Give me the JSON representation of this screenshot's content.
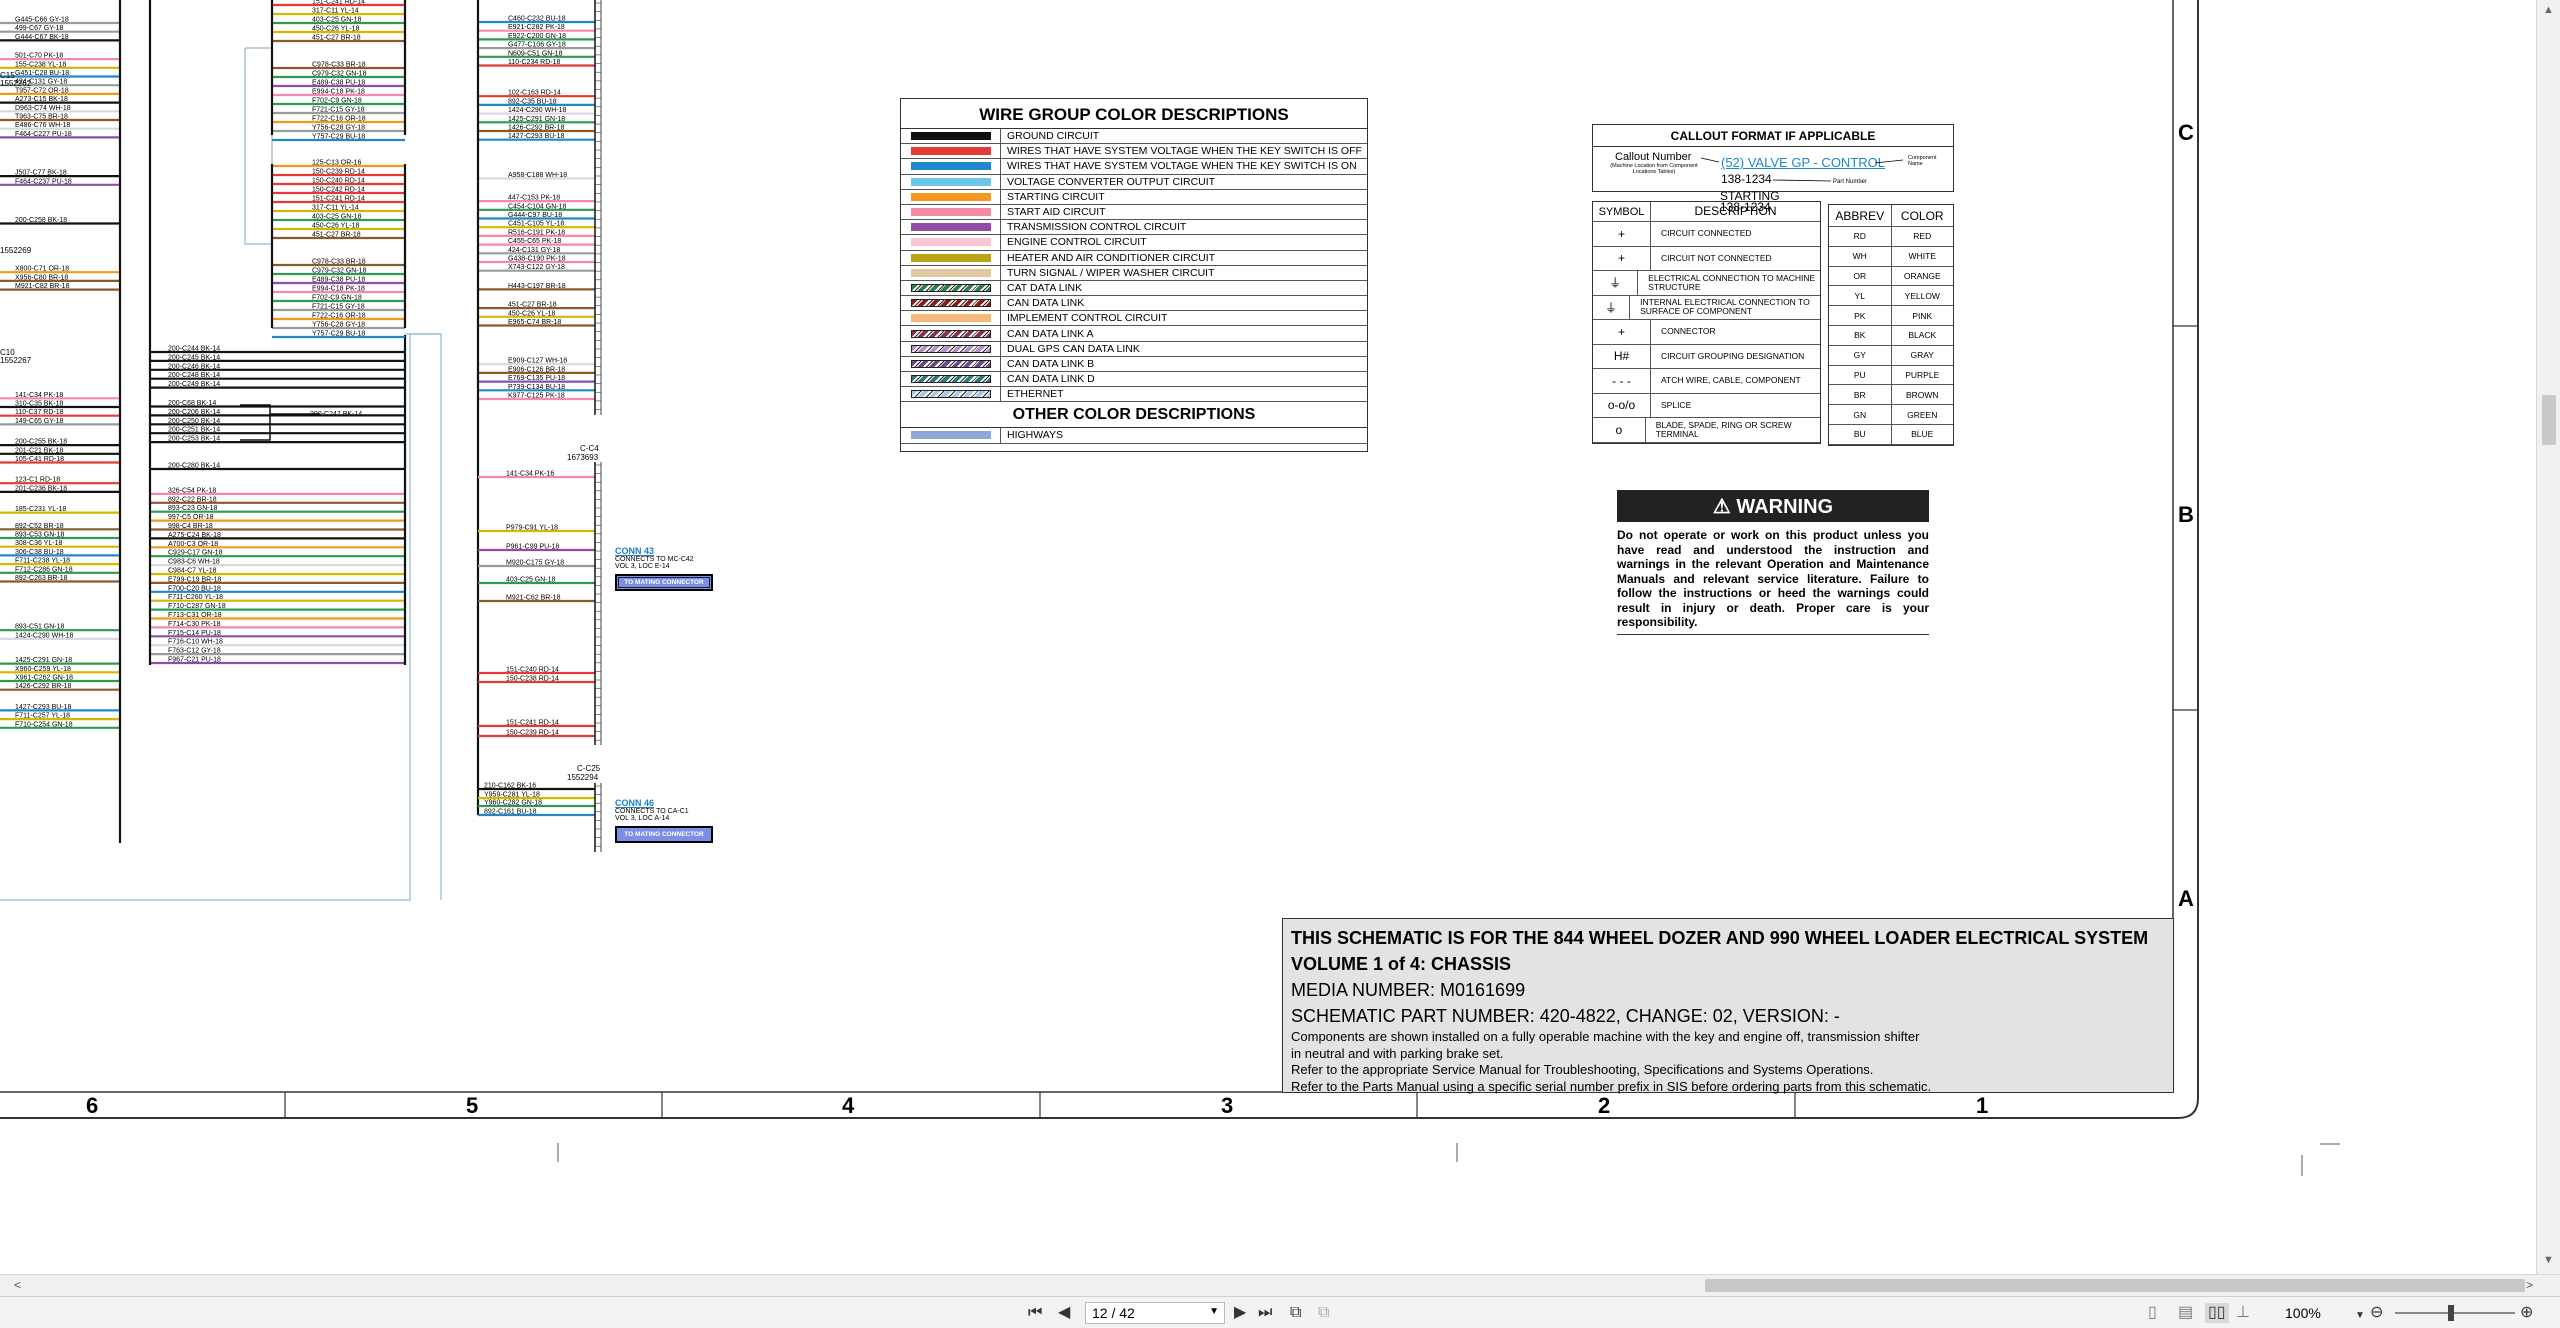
{
  "wire_legend": {
    "title": "WIRE GROUP COLOR DESCRIPTIONS",
    "other_title": "OTHER COLOR DESCRIPTIONS",
    "rows": [
      {
        "label": "GROUND CIRCUIT",
        "color": "#111111",
        "style": "solid"
      },
      {
        "label": "WIRES THAT HAVE SYSTEM VOLTAGE WHEN THE KEY SWITCH IS OFF",
        "color": "#e53935",
        "style": "solid"
      },
      {
        "label": "WIRES THAT HAVE SYSTEM VOLTAGE WHEN THE KEY SWITCH IS ON",
        "color": "#1e88c8",
        "style": "solid"
      },
      {
        "label": "VOLTAGE CONVERTER OUTPUT CIRCUIT",
        "color": "#6ec6e8",
        "style": "solid"
      },
      {
        "label": "STARTING CIRCUIT",
        "color": "#f39a1e",
        "style": "solid"
      },
      {
        "label": "START AID CIRCUIT",
        "color": "#f48aa8",
        "style": "solid"
      },
      {
        "label": "TRANSMISSION CONTROL CIRCUIT",
        "color": "#8e4ea6",
        "style": "solid"
      },
      {
        "label": "ENGINE CONTROL CIRCUIT",
        "color": "#f7c6d0",
        "style": "solid"
      },
      {
        "label": "HEATER AND AIR CONDITIONER CIRCUIT",
        "color": "#b8a419",
        "style": "solid"
      },
      {
        "label": "TURN SIGNAL / WIPER WASHER CIRCUIT",
        "color": "#e0c9a0",
        "style": "solid"
      },
      {
        "label": "CAT DATA LINK",
        "color": "#2e7d4f",
        "style": "hatch"
      },
      {
        "label": "CAN DATA LINK",
        "color": "#8b1a1a",
        "style": "hatch"
      },
      {
        "label": "IMPLEMENT CONTROL CIRCUIT",
        "color": "#f2b97a",
        "style": "solid"
      },
      {
        "label": "CAN DATA LINK A",
        "color": "#8a2b5a",
        "style": "hatch"
      },
      {
        "label": "DUAL GPS CAN DATA LINK",
        "color": "#b48cc8",
        "style": "hatch"
      },
      {
        "label": "CAN DATA LINK B",
        "color": "#6a4a8a",
        "style": "hatch"
      },
      {
        "label": "CAN DATA LINK D",
        "color": "#2a7a7a",
        "style": "hatch"
      },
      {
        "label": "ETHERNET",
        "color": "#a8c8e8",
        "style": "hatch"
      }
    ],
    "other_rows": [
      {
        "label": "HIGHWAYS",
        "color": "#8fa8d8",
        "style": "solid"
      }
    ]
  },
  "callout": {
    "title": "CALLOUT FORMAT IF APPLICABLE",
    "callout_number_label": "Callout Number",
    "callout_number_sub": "(Machine Location from Component Locations Tables)",
    "example_link": "(52) VALVE GP - CONTROL",
    "component_name_label": "Component Name",
    "part_number_1": "138-1234",
    "part_number_label": "Part Number",
    "part_number_2": "STARTING",
    "part_number_3": "138-1234",
    "symbol_header": "SYMBOL",
    "description_header": "DESCRIPTION",
    "symbols": [
      {
        "symbol": "+",
        "description": "CIRCUIT CONNECTED",
        "icon": "circuit-connected-icon"
      },
      {
        "symbol": "+",
        "description": "CIRCUIT NOT CONNECTED",
        "icon": "circuit-not-connected-icon"
      },
      {
        "symbol": "⏚",
        "description": "ELECTRICAL CONNECTION TO MACHINE STRUCTURE",
        "icon": "chassis-ground-icon"
      },
      {
        "symbol": "⏚",
        "description": "INTERNAL ELECTRICAL CONNECTION TO SURFACE OF COMPONENT",
        "icon": "surface-ground-icon"
      },
      {
        "symbol": "+",
        "description": "CONNECTOR",
        "icon": "connector-icon"
      },
      {
        "symbol": "H#",
        "description": "CIRCUIT GROUPING DESIGNATION",
        "icon": "grouping-icon"
      },
      {
        "symbol": "- - -",
        "description": "ATCH WIRE, CABLE, COMPONENT",
        "icon": "attachment-icon"
      },
      {
        "symbol": "o-o/o",
        "description": "SPLICE",
        "icon": "splice-icon"
      },
      {
        "symbol": "o",
        "description": "BLADE, SPADE, RING OR SCREW TERMINAL",
        "icon": "terminal-icon"
      }
    ],
    "abbrev_header": "ABBREV",
    "color_header": "COLOR",
    "abbreviations": [
      {
        "abbrev": "RD",
        "color": "RED"
      },
      {
        "abbrev": "WH",
        "color": "WHITE"
      },
      {
        "abbrev": "OR",
        "color": "ORANGE"
      },
      {
        "abbrev": "YL",
        "color": "YELLOW"
      },
      {
        "abbrev": "PK",
        "color": "PINK"
      },
      {
        "abbrev": "BK",
        "color": "BLACK"
      },
      {
        "abbrev": "GY",
        "color": "GRAY"
      },
      {
        "abbrev": "PU",
        "color": "PURPLE"
      },
      {
        "abbrev": "BR",
        "color": "BROWN"
      },
      {
        "abbrev": "GN",
        "color": "GREEN"
      },
      {
        "abbrev": "BU",
        "color": "BLUE"
      }
    ]
  },
  "warning": {
    "title": "WARNING",
    "text": "Do not operate or work on this product unless you have read and understood the instruction and warnings in the relevant Operation and Maintenance Manuals and relevant service literature. Failure to follow the instructions or heed the warnings could result in injury or death. Proper care is your responsibility."
  },
  "title_block": {
    "line1": "THIS SCHEMATIC IS FOR THE 844 WHEEL DOZER AND 990 WHEEL LOADER ELECTRICAL SYSTEM",
    "line2": "VOLUME 1 of 4: CHASSIS",
    "line3": "MEDIA NUMBER: M0161699",
    "line4": "SCHEMATIC PART NUMBER: 420-4822, CHANGE: 02, VERSION: -",
    "note1": "Components are shown installed on a fully operable machine with the key and engine off, transmission shifter",
    "note2": "in neutral and with parking brake set.",
    "note3": "Refer to the appropriate Service Manual for Troubleshooting, Specifications and Systems Operations.",
    "note4": "Refer to the Parts Manual using a specific serial number prefix in SIS before ordering parts from this schematic."
  },
  "frame": {
    "columns": [
      "6",
      "5",
      "4",
      "3",
      "2",
      "1"
    ],
    "rows": [
      "C",
      "B",
      "A"
    ]
  },
  "connectors": {
    "c4": {
      "id": "C-C4",
      "part": "1673693"
    },
    "c25": {
      "id": "C-C25",
      "part": "1552294"
    },
    "conn43": {
      "link": "CONN 43",
      "line1": "CONNECTS TO MC-C42",
      "line2": "VOL 3, LOC E-14",
      "button": "TO MATING CONNECTOR"
    },
    "conn46": {
      "link": "CONN 46",
      "line1": "CONNECTS TO CA-C1",
      "line2": "VOL 3, LOC A-14",
      "button": "TO MATING CONNECTOR"
    }
  },
  "wires": {
    "leftmost": [
      "G445-C66 GY-18",
      "499-C67 GY-18",
      "G444-C67 BK-18",
      "501-C70 PK-18",
      "155-C238 YL-18",
      "G451-C28 BU-18",
      "424-C131 GY-18",
      "T957-C72 OR-18",
      "A273-C15 BK-18",
      "D963-C74 WH-18",
      "T963-C75 BR-18",
      "E486-C76 WH-18",
      "F464-C227 PU-18",
      "J507-C77 BK-18",
      "F464-C237 PU-18",
      "200-C258 BK-18",
      "X800-C71 OR-18",
      "X956-C80 BR-18",
      "M921-C82 BR-18",
      "141-C34 PK-18",
      "310-C35 BK-18",
      "110-C37 RD-18",
      "149-C65 GY-18",
      "200-C255 BK-18",
      "201-C21 BK-18",
      "105-C41 RD-18",
      "123-C1 RD-18",
      "201-C236 BK-18",
      "185-C231 YL-18",
      "892-C52 BR-18",
      "893-C53 GN-18",
      "308-C36 YL-18",
      "306-C38 BU-18",
      "F711-C238 YL-18",
      "F712-C286 GN-18",
      "892-C263 BR-18",
      "893-C51 GN-18",
      "1424-C290 WH-18",
      "1425-C291 GN-18",
      "X960-C259 YL-18",
      "X961-C262 GN-18",
      "1426-C292 BR-18",
      "1427-C293 BU-18",
      "F711-C257 YL-18",
      "F710-C254 GN-18"
    ],
    "left_bus": [
      "200-C244 BK-14",
      "200-C245 BK-14",
      "200-C246 BK-14",
      "200-C248 BK-14",
      "200-C249 BK-14",
      "200-C68 BK-14",
      "200-C206 BK-14",
      "200-C250 BK-14",
      "200-C251 BK-14",
      "200-C253 BK-14",
      "200-C280 BK-14",
      "326-C54 PK-18",
      "892-C22 BR-18",
      "893-C23 GN-18",
      "997-C5 OR-18",
      "998-C4 BR-18",
      "A275-C24 BK-18",
      "A700-C3 OR-18",
      "C929-C17 GN-18",
      "C983-C6 WH-18",
      "C984-C7 YL-18",
      "E799-C19 BR-18",
      "F700-C20 BU-18",
      "F711-C260 YL-18",
      "F710-C287 GN-18",
      "F713-C31 OR-18",
      "F714-C30 PK-18",
      "F715-C14 PU-18",
      "F716-C10 WH-18",
      "F763-C12 GY-18",
      "F967-C21 PU-18"
    ],
    "bus_junction": "200-C247 BK-14",
    "center_top": [
      "151-C241 RD-14",
      "317-C11 YL-14",
      "403-C25 GN-18",
      "450-C26 YL-18",
      "451-C27 BR-18",
      "C978-C33 BR-18",
      "C979-C32 GN-18",
      "E489-C38 PU-18",
      "E994-C18 PK-18",
      "F702-C9 GN-18",
      "F721-C15 GY-18",
      "F722-C16 OR-18",
      "Y756-C28 GY-18",
      "Y757-C29 BU-18"
    ],
    "center_mid": [
      "125-C13 OR-16",
      "150-C239 RD-14",
      "150-C240 RD-14",
      "150-C242 RD-14",
      "151-C241 RD-14",
      "317-C11 YL-14",
      "403-C25 GN-18",
      "450-C26 YL-18",
      "451-C27 BR-18",
      "C978-C33 BR-18",
      "C979-C32 GN-18",
      "E489-C38 PU-18",
      "E994-C18 PK-18",
      "F702-C9 GN-18",
      "F721-C15 GY-18",
      "F722-C16 OR-18",
      "Y756-C28 GY-18",
      "Y757-C29 BU-18"
    ],
    "right_top": [
      "C460-C232 BU-18",
      "E921-C282 PK-18",
      "E922-C200 GN-18",
      "G477-C106 GY-18",
      "N609-C51 GN-18",
      "110-C234 RD-18",
      "102-C163 RD-14",
      "892-C35 BU-18",
      "1424-C290 WH-18",
      "1425-C291 GN-18",
      "1426-C292 BR-18",
      "1427-C293 BU-18",
      "A958-C188 WH-18",
      "447-C153 PK-18",
      "C454-C104 GN-18",
      "G444-C97 BU-18",
      "C451-C105 YL-18",
      "R516-C191 PK-18",
      "C455-C65 PK-18",
      "424-C131 GY-18",
      "G438-C190 PK-18",
      "X743-C122 GY-18",
      "H443-C197 BR-18",
      "451-C27 BR-18",
      "450-C26 YL-18",
      "E965-C74 BR-18",
      "E909-C127 WH-18",
      "E906-C126 BR-18",
      "E769-C135 PU-18",
      "P739-C134 BU-18",
      "K977-C125 PK-18"
    ],
    "right_mid": [
      "141-C34 PK-16",
      "P979-C91 YL-18",
      "P961-C99 PU-18",
      "M920-C175 GY-18",
      "403-C25 GN-18",
      "M921-C62 BR-18",
      "151-C240 RD-14",
      "150-C238 RD-14",
      "151-C241 RD-14",
      "150-C239 RD-14"
    ],
    "right_bottom": [
      "210-C162 BK-16",
      "Y959-C281 YL-18",
      "Y960-C282 GN-18",
      "892-C161 BU-18"
    ]
  },
  "left_labels": [
    "C15",
    "1552262",
    "C10",
    "1552267",
    "1552269"
  ],
  "viewer": {
    "page_value": "12 / 42",
    "zoom": "100%"
  }
}
